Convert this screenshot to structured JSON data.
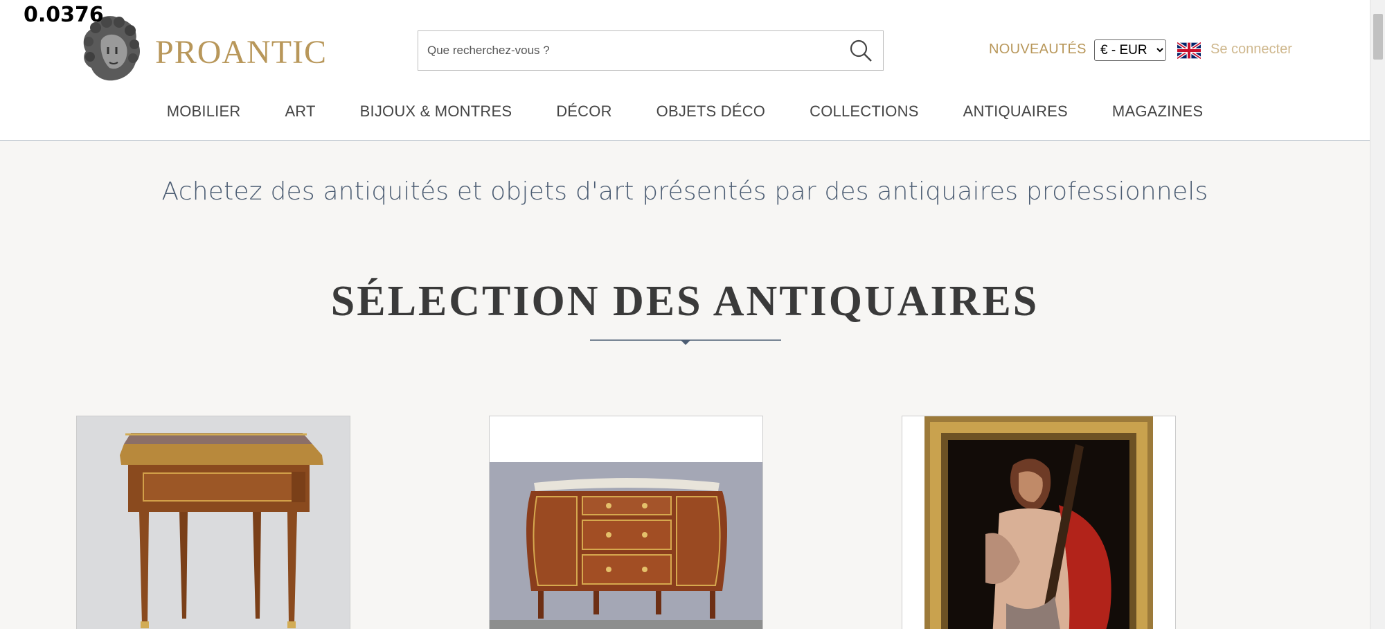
{
  "overlay": {
    "value": "0.0376"
  },
  "header": {
    "brand": "PROANTIC",
    "search_placeholder": "Que recherchez-vous ?",
    "nouveautes": "NOUVEAUTÉS",
    "currency": {
      "selected": "€ - EUR"
    },
    "login": "Se connecter",
    "nav": [
      "MOBILIER",
      "ART",
      "BIJOUX & MONTRES",
      "DÉCOR",
      "OBJETS DÉCO",
      "COLLECTIONS",
      "ANTIQUAIRES",
      "MAGAZINES"
    ]
  },
  "main": {
    "tagline": "Achetez des antiquités et objets d'art présentés par des antiquaires professionnels",
    "section_title": "SÉLECTION DES ANTIQUAIRES"
  },
  "colors": {
    "brand_gold": "#b8975a",
    "tagline_blue": "#4c5d73",
    "background": "#f7f6f4"
  }
}
